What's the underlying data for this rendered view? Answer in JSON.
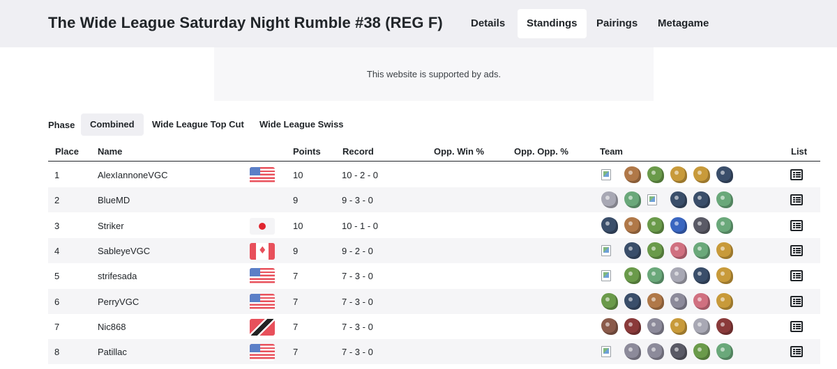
{
  "header": {
    "title": "The Wide League Saturday Night Rumble #38 (REG F)",
    "tabs": [
      "Details",
      "Standings",
      "Pairings",
      "Metagame"
    ]
  },
  "ad": {
    "text": "This website is supported by ads."
  },
  "phase": {
    "label": "Phase",
    "tabs": [
      "Combined",
      "Wide League Top Cut",
      "Wide League Swiss"
    ],
    "active": "Combined"
  },
  "table": {
    "headers": {
      "place": "Place",
      "name": "Name",
      "points": "Points",
      "record": "Record",
      "opp_win": "Opp. Win %",
      "opp_opp": "Opp. Opp. %",
      "team": "Team",
      "list": "List"
    },
    "rows": [
      {
        "place": "1",
        "name": "AlexIannoneVGC",
        "flag": "us",
        "points": "10",
        "record": "10 - 2 - 0"
      },
      {
        "place": "2",
        "name": "BlueMD",
        "flag": "",
        "points": "9",
        "record": "9 - 3 - 0"
      },
      {
        "place": "3",
        "name": "Striker",
        "flag": "jp",
        "points": "10",
        "record": "10 - 1 - 0"
      },
      {
        "place": "4",
        "name": "SableyeVGC",
        "flag": "ca",
        "points": "9",
        "record": "9 - 2 - 0"
      },
      {
        "place": "5",
        "name": "strifesada",
        "flag": "us",
        "points": "7",
        "record": "7 - 3 - 0"
      },
      {
        "place": "6",
        "name": "PerryVGC",
        "flag": "us",
        "points": "7",
        "record": "7 - 3 - 0"
      },
      {
        "place": "7",
        "name": "Nic868",
        "flag": "tt",
        "points": "7",
        "record": "7 - 3 - 0"
      },
      {
        "place": "8",
        "name": "Patillac",
        "flag": "us",
        "points": "7",
        "record": "7 - 3 - 0"
      }
    ]
  },
  "colors": {
    "topbar": "#efeff3",
    "sprite_palette": {
      "a": "#6a9a4a",
      "b": "#3a4e6a",
      "c": "#b07848",
      "d": "#c89a3a",
      "e": "#6aa87a",
      "f": "#8c8a9a",
      "g": "#3a66c0",
      "h": "#d07080",
      "i": "#8a5a4a",
      "j": "#a8a8b4",
      "k": "#8a3a3a",
      "l": "#5a5a66"
    }
  },
  "teams": [
    [
      "x",
      "c",
      "a",
      "d",
      "d",
      "b"
    ],
    [
      "j",
      "e",
      "x",
      "b",
      "b",
      "e"
    ],
    [
      "b",
      "c",
      "a",
      "g",
      "l",
      "e"
    ],
    [
      "x",
      "b",
      "a",
      "h",
      "e",
      "d"
    ],
    [
      "x",
      "a",
      "e",
      "j",
      "b",
      "d"
    ],
    [
      "a",
      "b",
      "c",
      "f",
      "h",
      "d"
    ],
    [
      "i",
      "k",
      "f",
      "d",
      "j",
      "k"
    ],
    [
      "x",
      "f",
      "f",
      "l",
      "a",
      "e"
    ]
  ]
}
